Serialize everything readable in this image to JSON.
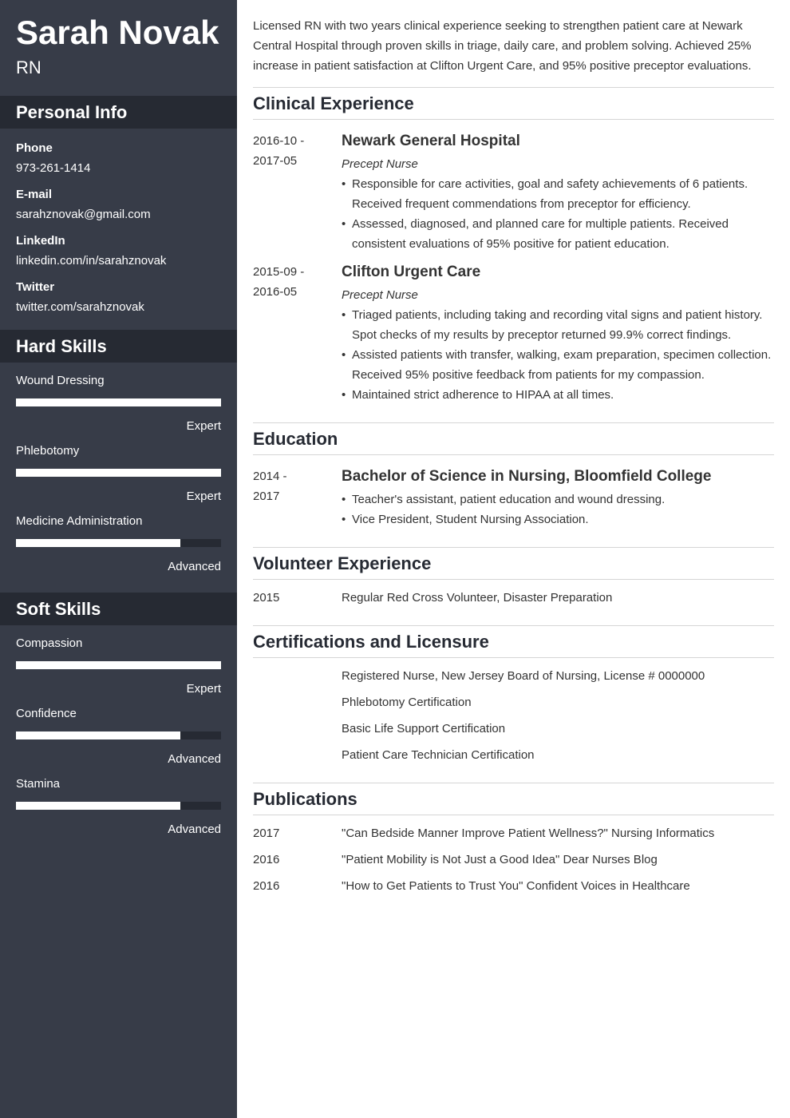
{
  "header": {
    "name": "Sarah Novak",
    "title": "RN"
  },
  "sidebar": {
    "personal_info": {
      "heading": "Personal Info",
      "items": [
        {
          "label": "Phone",
          "value": "973-261-1414"
        },
        {
          "label": "E-mail",
          "value": "sarahznovak@gmail.com"
        },
        {
          "label": "LinkedIn",
          "value": "linkedin.com/in/sarahznovak"
        },
        {
          "label": "Twitter",
          "value": "twitter.com/sarahznovak"
        }
      ]
    },
    "hard_skills": {
      "heading": "Hard Skills",
      "items": [
        {
          "name": "Wound Dressing",
          "level": "Expert",
          "fraction": 1.0
        },
        {
          "name": "Phlebotomy",
          "level": "Expert",
          "fraction": 1.0
        },
        {
          "name": "Medicine Administration",
          "level": "Advanced",
          "fraction": 0.8
        }
      ]
    },
    "soft_skills": {
      "heading": "Soft Skills",
      "items": [
        {
          "name": "Compassion",
          "level": "Expert",
          "fraction": 1.0
        },
        {
          "name": "Confidence",
          "level": "Advanced",
          "fraction": 0.8
        },
        {
          "name": "Stamina",
          "level": "Advanced",
          "fraction": 0.8
        }
      ]
    }
  },
  "colors": {
    "sidebar": "#373c48",
    "sidebar_header": "#262a33",
    "bar_fill": "#ffffff",
    "text": "#333333"
  },
  "main": {
    "summary": "Licensed RN with two years clinical experience seeking to strengthen patient care at Newark Central Hospital through proven skills in triage, daily care, and problem solving. Achieved 25% increase in patient satisfaction at Clifton Urgent Care, and 95% positive preceptor evaluations.",
    "experience": {
      "heading": "Clinical Experience",
      "items": [
        {
          "date_start": "2016-10 -",
          "date_end": "2017-05",
          "org": "Newark General Hospital",
          "role": "Precept Nurse",
          "bullets": [
            "Responsible for care activities, goal and safety achievements of 6 patients. Received frequent commendations from preceptor for efficiency.",
            "Assessed, diagnosed, and planned care for multiple patients. Received consistent evaluations of 95% positive for patient education."
          ]
        },
        {
          "date_start": "2015-09 -",
          "date_end": "2016-05",
          "org": "Clifton Urgent Care",
          "role": "Precept Nurse",
          "bullets": [
            "Triaged patients, including taking and recording vital signs and patient history. Spot checks of my results by preceptor returned 99.9% correct findings.",
            "Assisted patients with transfer, walking, exam preparation, specimen collection. Received 95% positive feedback from patients for my compassion.",
            "Maintained strict adherence to HIPAA at all times."
          ]
        }
      ]
    },
    "education": {
      "heading": "Education",
      "items": [
        {
          "date_start": "2014 -",
          "date_end": "2017",
          "org": "Bachelor of Science in Nursing, Bloomfield College",
          "bullets": [
            "Teacher's assistant, patient education and wound dressing.",
            "Vice President, Student Nursing Association."
          ]
        }
      ]
    },
    "volunteer": {
      "heading": "Volunteer Experience",
      "items": [
        {
          "date": "2015",
          "text": "Regular Red Cross Volunteer, Disaster Preparation"
        }
      ]
    },
    "certifications": {
      "heading": "Certifications and Licensure",
      "items": [
        {
          "date": "",
          "text": "Registered Nurse, New Jersey Board of Nursing, License # 0000000"
        },
        {
          "date": "",
          "text": "Phlebotomy Certification"
        },
        {
          "date": "",
          "text": "Basic Life Support Certification"
        },
        {
          "date": "",
          "text": "Patient Care Technician Certification"
        }
      ]
    },
    "publications": {
      "heading": "Publications",
      "items": [
        {
          "date": "2017",
          "text": "\"Can Bedside Manner Improve Patient Wellness?\" Nursing Informatics"
        },
        {
          "date": "2016",
          "text": "\"Patient Mobility is Not Just a Good Idea\" Dear Nurses Blog"
        },
        {
          "date": "2016",
          "text": "\"How to Get Patients to Trust You\" Confident Voices in Healthcare"
        }
      ]
    }
  }
}
